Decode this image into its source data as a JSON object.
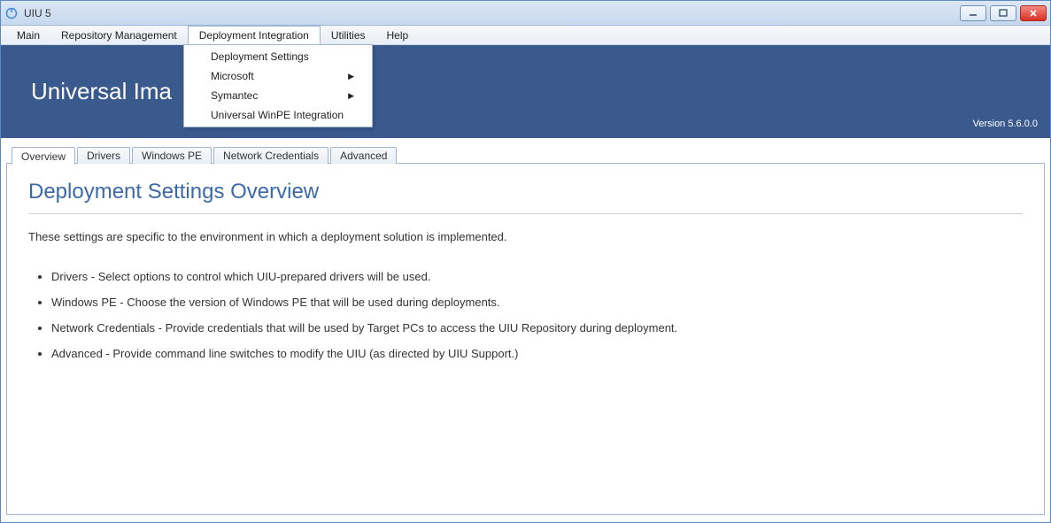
{
  "window": {
    "title": "UIU 5"
  },
  "menubar": {
    "items": [
      "Main",
      "Repository Management",
      "Deployment Integration",
      "Utilities",
      "Help"
    ],
    "active_index": 2
  },
  "dropdown": {
    "items": [
      {
        "label": "Deployment Settings",
        "submenu": false
      },
      {
        "label": "Microsoft",
        "submenu": true
      },
      {
        "label": "Symantec",
        "submenu": true
      },
      {
        "label": "Universal WinPE Integration",
        "submenu": false
      }
    ]
  },
  "banner": {
    "title": "Universal Ima",
    "version": "Version 5.6.0.0"
  },
  "tabs": {
    "items": [
      "Overview",
      "Drivers",
      "Windows PE",
      "Network Credentials",
      "Advanced"
    ],
    "active_index": 0
  },
  "pane": {
    "title": "Deployment Settings Overview",
    "intro": "These settings are specific to the environment in which a deployment solution is implemented.",
    "bullets": [
      "Drivers - Select options to control which UIU-prepared drivers will be used.",
      "Windows PE - Choose the version of Windows PE that will be used during deployments.",
      "Network Credentials - Provide credentials that will be used by Target PCs to access the UIU Repository during deployment.",
      "Advanced - Provide command line switches to modify the UIU (as directed by UIU Support.)"
    ]
  }
}
